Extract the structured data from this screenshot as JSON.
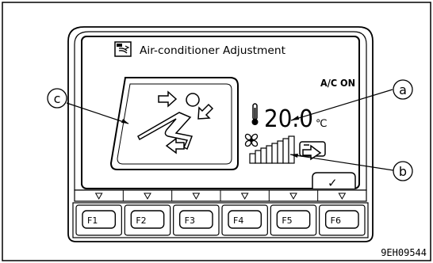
{
  "screen": {
    "title": "Air-conditioner Adjustment",
    "ac_status": "A/C ON",
    "temperature_value": "20.0",
    "temperature_unit": "℃",
    "confirm_symbol": "✓"
  },
  "callouts": {
    "a": "a",
    "b": "b",
    "c": "c"
  },
  "function_keys": [
    {
      "label": "F1"
    },
    {
      "label": "F2"
    },
    {
      "label": "F3"
    },
    {
      "label": "F4"
    },
    {
      "label": "F5"
    },
    {
      "label": "F6"
    }
  ],
  "figure_code": "9EH09544",
  "icons": {
    "title": "air-conditioner-icon",
    "seat": "seat-airflow-icon",
    "thermometer": "thermometer-icon",
    "fan": "fan-icon",
    "fan_level": "fan-level-bars-icon",
    "mode": "airflow-mode-icon",
    "key_marker": "triangle-down-icon"
  },
  "colors": {
    "line": "#000000",
    "background": "#ffffff"
  }
}
